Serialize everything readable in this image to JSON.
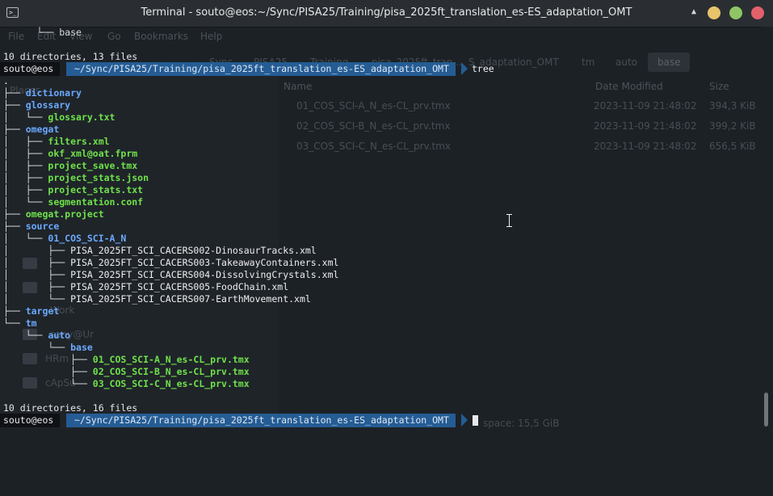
{
  "window": {
    "title": "Terminal - souto@eos:~/Sync/PISA25/Training/pisa_2025ft_translation_es-ES_adaptation_OMT"
  },
  "background_app": {
    "menu": [
      "File",
      "Edit",
      "View",
      "Go",
      "Bookmarks",
      "Help"
    ],
    "crumbs": [
      "Sync",
      "PISA25",
      "Training",
      "pisa_2025ft_tran...",
      "S_adaptation_OMT",
      "tm",
      "auto",
      "base"
    ],
    "sidebar": [
      "Places",
      "Work",
      "sany@Ur",
      "HRm",
      "cApSu"
    ],
    "columns": [
      "Name",
      "Date Modified",
      "Size"
    ],
    "rows": [
      {
        "name": "01_COS_SCI-A_N_es-CL_prv.tmx",
        "date": "2023-11-09 21:48:02",
        "size": "394,3 KiB"
      },
      {
        "name": "02_COS_SCI-B_N_es-CL_prv.tmx",
        "date": "2023-11-09 21:48:02",
        "size": "399,2 KiB"
      },
      {
        "name": "03_COS_SCI-C_N_es-CL_prv.tmx",
        "date": "2023-11-09 21:48:02",
        "size": "656,5 KiB"
      }
    ],
    "free_space": "space: 15,5 GiB"
  },
  "terminal": {
    "prompt_user": "souto@eos",
    "prompt_path": "~/Sync/PISA25/Training/pisa_2025ft_translation_es-ES_adaptation_OMT",
    "command": "tree",
    "top_tree_line": "└── base",
    "summary_before": "10 directories, 13 files",
    "root": ".",
    "tree": [
      {
        "prefix": "├── ",
        "name": "dictionary",
        "kind": "dir"
      },
      {
        "prefix": "├── ",
        "name": "glossary",
        "kind": "dir"
      },
      {
        "prefix": "│   └── ",
        "name": "glossary.txt",
        "kind": "file"
      },
      {
        "prefix": "├── ",
        "name": "omegat",
        "kind": "dir"
      },
      {
        "prefix": "│   ├── ",
        "name": "filters.xml",
        "kind": "file"
      },
      {
        "prefix": "│   ├── ",
        "name": "okf_xml@oat.fprm",
        "kind": "file"
      },
      {
        "prefix": "│   ├── ",
        "name": "project_save.tmx",
        "kind": "file"
      },
      {
        "prefix": "│   ├── ",
        "name": "project_stats.json",
        "kind": "file"
      },
      {
        "prefix": "│   ├── ",
        "name": "project_stats.txt",
        "kind": "file"
      },
      {
        "prefix": "│   └── ",
        "name": "segmentation.conf",
        "kind": "file"
      },
      {
        "prefix": "├── ",
        "name": "omegat.project",
        "kind": "file"
      },
      {
        "prefix": "├── ",
        "name": "source",
        "kind": "dir"
      },
      {
        "prefix": "│   └── ",
        "name": "01_COS_SCI-A_N",
        "kind": "dir"
      },
      {
        "prefix": "│       ├── ",
        "name": "PISA_2025FT_SCI_CACERS002-DinosaurTracks.xml",
        "kind": "plain"
      },
      {
        "prefix": "│       ├── ",
        "name": "PISA_2025FT_SCI_CACERS003-TakeawayContainers.xml",
        "kind": "plain"
      },
      {
        "prefix": "│       ├── ",
        "name": "PISA_2025FT_SCI_CACERS004-DissolvingCrystals.xml",
        "kind": "plain"
      },
      {
        "prefix": "│       ├── ",
        "name": "PISA_2025FT_SCI_CACERS005-FoodChain.xml",
        "kind": "plain"
      },
      {
        "prefix": "│       └── ",
        "name": "PISA_2025FT_SCI_CACERS007-EarthMovement.xml",
        "kind": "plain"
      },
      {
        "prefix": "├── ",
        "name": "target",
        "kind": "dir"
      },
      {
        "prefix": "└── ",
        "name": "tm",
        "kind": "dir"
      },
      {
        "prefix": "    └── ",
        "name": "auto",
        "kind": "dir"
      },
      {
        "prefix": "        └── ",
        "name": "base",
        "kind": "dir"
      },
      {
        "prefix": "            ├── ",
        "name": "01_COS_SCI-A_N_es-CL_prv.tmx",
        "kind": "file"
      },
      {
        "prefix": "            ├── ",
        "name": "02_COS_SCI-B_N_es-CL_prv.tmx",
        "kind": "file"
      },
      {
        "prefix": "            └── ",
        "name": "03_COS_SCI-C_N_es-CL_prv.tmx",
        "kind": "file"
      }
    ],
    "summary_after": "10 directories, 16 files"
  },
  "colors": {
    "background": "#1c2126",
    "directory": "#6aa9ff",
    "file": "#6fe24a",
    "prompt_path_bg": "#255c94"
  }
}
